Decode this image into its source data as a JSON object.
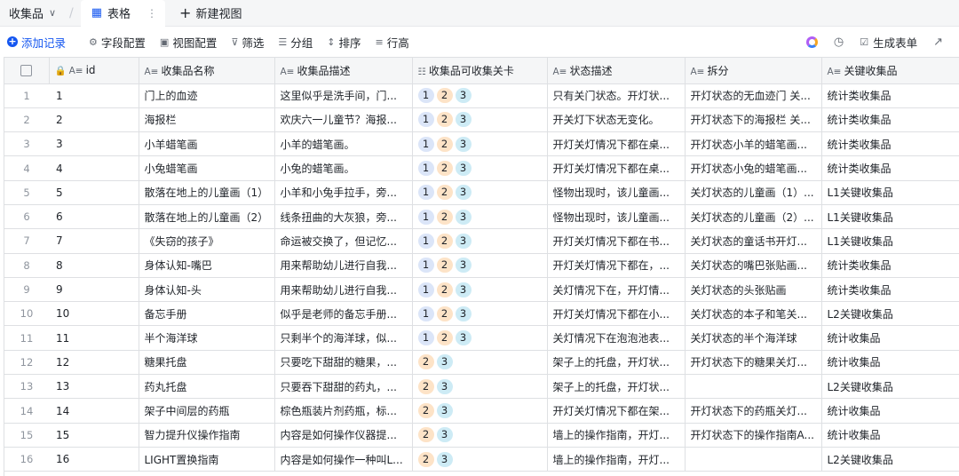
{
  "viewbar": {
    "collection": "收集品",
    "tab_label": "表格",
    "new_view": "新建视图"
  },
  "toolbar": {
    "add_record": "添加记录",
    "field_config": "字段配置",
    "view_config": "视图配置",
    "filter": "筛选",
    "group": "分组",
    "sort": "排序",
    "row_height": "行高",
    "generate_form": "生成表单"
  },
  "table": {
    "columns": [
      {
        "name": "id",
        "icon": "text-field-icon"
      },
      {
        "name": "收集品名称",
        "icon": "text-field-icon"
      },
      {
        "name": "收集品描述",
        "icon": "text-field-icon"
      },
      {
        "name": "收集品可收集关卡",
        "icon": "multi-select-icon"
      },
      {
        "name": "状态描述",
        "icon": "text-field-icon"
      },
      {
        "name": "拆分",
        "icon": "text-field-icon"
      },
      {
        "name": "关键收集品",
        "icon": "text-field-icon"
      }
    ],
    "rows": [
      {
        "num": "1",
        "id": "1",
        "name": "门上的血迹",
        "desc": "这里似乎是洗手间，门...",
        "levels": [
          "1",
          "2",
          "3"
        ],
        "state": "只有关门状态。开灯状...",
        "split": "开灯状态的无血迹门 关...",
        "key": "统计类收集品"
      },
      {
        "num": "2",
        "id": "2",
        "name": "海报栏",
        "desc": "欢庆六一儿童节？海报...",
        "levels": [
          "1",
          "2",
          "3"
        ],
        "state": "开关灯下状态无变化。",
        "split": "开灯状态下的海报栏 关...",
        "key": "统计类收集品"
      },
      {
        "num": "3",
        "id": "3",
        "name": "小羊蜡笔画",
        "desc": "小羊的蜡笔画。",
        "levels": [
          "1",
          "2",
          "3"
        ],
        "state": "开灯关灯情况下都在桌...",
        "split": "开灯状态小羊的蜡笔画...",
        "key": "统计类收集品"
      },
      {
        "num": "4",
        "id": "4",
        "name": "小兔蜡笔画",
        "desc": "小兔的蜡笔画。",
        "levels": [
          "1",
          "2",
          "3"
        ],
        "state": "开灯关灯情况下都在桌...",
        "split": "开灯状态小兔的蜡笔画...",
        "key": "统计类收集品"
      },
      {
        "num": "5",
        "id": "5",
        "name": "散落在地上的儿童画（1）",
        "desc": "小羊和小兔手拉手，旁...",
        "levels": [
          "1",
          "2",
          "3"
        ],
        "state": "怪物出现时，该儿童画...",
        "split": "关灯状态的儿童画（1）...",
        "key": "L1关键收集品"
      },
      {
        "num": "6",
        "id": "6",
        "name": "散落在地上的儿童画（2）",
        "desc": "线条扭曲的大灰狼，旁...",
        "levels": [
          "1",
          "2",
          "3"
        ],
        "state": "怪物出现时，该儿童画...",
        "split": "关灯状态的儿童画（2）...",
        "key": "L1关键收集品"
      },
      {
        "num": "7",
        "id": "7",
        "name": "《失窃的孩子》",
        "desc": "命运被交换了，但记忆...",
        "levels": [
          "1",
          "2",
          "3"
        ],
        "state": "开灯关灯情况下都在书...",
        "split": "关灯状态的童话书开灯...",
        "key": "L1关键收集品"
      },
      {
        "num": "8",
        "id": "8",
        "name": "身体认知-嘴巴",
        "desc": "用来帮助幼儿进行自我...",
        "levels": [
          "1",
          "2",
          "3"
        ],
        "state": "开灯关灯情况下都在，...",
        "split": "关灯状态的嘴巴张贴画...",
        "key": "统计类收集品"
      },
      {
        "num": "9",
        "id": "9",
        "name": "身体认知-头",
        "desc": "用来帮助幼儿进行自我...",
        "levels": [
          "1",
          "2",
          "3"
        ],
        "state": "关灯情况下在，开灯情...",
        "split": "关灯状态的头张贴画",
        "key": "统计类收集品"
      },
      {
        "num": "10",
        "id": "10",
        "name": "备忘手册",
        "desc": "似乎是老师的备忘手册...",
        "levels": [
          "1",
          "2",
          "3"
        ],
        "state": "开灯关灯情况下都在小...",
        "split": "关灯状态的本子和笔关...",
        "key": "L2关键收集品"
      },
      {
        "num": "11",
        "id": "11",
        "name": "半个海洋球",
        "desc": "只剩半个的海洋球，似...",
        "levels": [
          "1",
          "2",
          "3"
        ],
        "state": "关灯情况下在泡泡池表...",
        "split": "关灯状态的半个海洋球",
        "key": "统计收集品"
      },
      {
        "num": "12",
        "id": "12",
        "name": "糖果托盘",
        "desc": "只要吃下甜甜的糖果，...",
        "levels": [
          "2",
          "3"
        ],
        "state": "架子上的托盘，开灯状...",
        "split": "开灯状态下的糖果关灯...",
        "key": "统计收集品"
      },
      {
        "num": "13",
        "id": "13",
        "name": "药丸托盘",
        "desc": "只要吞下甜甜的药丸，...",
        "levels": [
          "2",
          "3"
        ],
        "state": "架子上的托盘，开灯状...",
        "split": "",
        "key": "L2关键收集品"
      },
      {
        "num": "14",
        "id": "14",
        "name": "架子中间层的药瓶",
        "desc": "棕色瓶装片剂药瓶，标...",
        "levels": [
          "2",
          "3"
        ],
        "state": "开灯关灯情况下都在架...",
        "split": "开灯状态下的药瓶关灯...",
        "key": "统计收集品"
      },
      {
        "num": "15",
        "id": "15",
        "name": "智力提升仪操作指南",
        "desc": "内容是如何操作仪器提...",
        "levels": [
          "2",
          "3"
        ],
        "state": "墙上的操作指南，开灯...",
        "split": "开灯状态下的操作指南A...",
        "key": "统计收集品"
      },
      {
        "num": "16",
        "id": "16",
        "name": "LIGHT置换指南",
        "desc": "内容是如何操作一种叫L...",
        "levels": [
          "2",
          "3"
        ],
        "state": "墙上的操作指南，开灯...",
        "split": "",
        "key": "L2关键收集品"
      }
    ]
  }
}
